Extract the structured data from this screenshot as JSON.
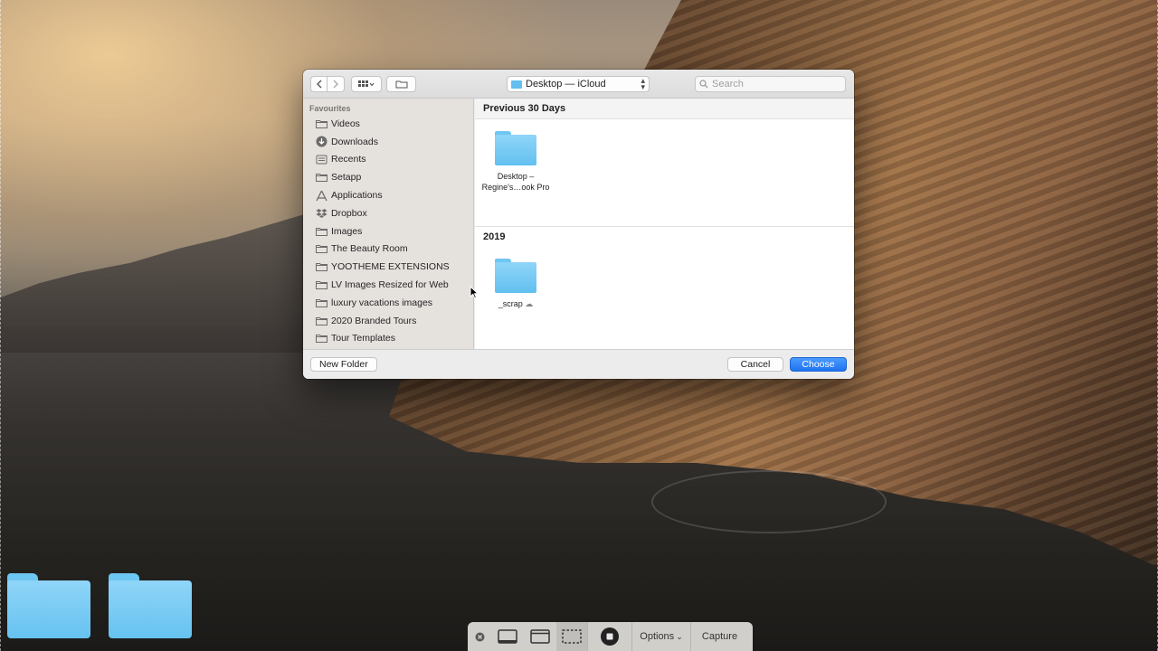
{
  "toolbar": {
    "back_icon": "chevron-left-icon",
    "forward_icon": "chevron-right-icon",
    "view_icon": "icon-grid-icon",
    "group_icon": "folder-tag-icon",
    "location": "Desktop — iCloud",
    "search_placeholder": "Search"
  },
  "sidebar": {
    "header": "Favourites",
    "items": [
      {
        "label": "Videos",
        "icon": "folder-icon"
      },
      {
        "label": "Downloads",
        "icon": "download-icon"
      },
      {
        "label": "Recents",
        "icon": "recents-icon"
      },
      {
        "label": "Setapp",
        "icon": "folder-icon"
      },
      {
        "label": "Applications",
        "icon": "applications-icon"
      },
      {
        "label": "Dropbox",
        "icon": "dropbox-icon"
      },
      {
        "label": "Images",
        "icon": "folder-icon"
      },
      {
        "label": "The Beauty Room",
        "icon": "folder-icon"
      },
      {
        "label": "YOOTHEME EXTENSIONS",
        "icon": "folder-icon"
      },
      {
        "label": "LV Images Resized for Web",
        "icon": "folder-icon"
      },
      {
        "label": "luxury vacations images",
        "icon": "folder-icon"
      },
      {
        "label": "2020 Branded Tours",
        "icon": "folder-icon"
      },
      {
        "label": "Tour Templates",
        "icon": "folder-icon"
      }
    ]
  },
  "content": {
    "sections": [
      {
        "title": "Previous 30 Days",
        "items": [
          {
            "name_line1": "Desktop –",
            "name_line2": "Regine's…ook Pro"
          }
        ]
      },
      {
        "title": "2019",
        "items": [
          {
            "name_line1": "_scrap",
            "cloud": "☁"
          }
        ]
      }
    ]
  },
  "footer": {
    "new_folder": "New Folder",
    "cancel": "Cancel",
    "choose": "Choose"
  },
  "capture_bar": {
    "options": "Options",
    "capture": "Capture"
  },
  "colors": {
    "accent": "#1f73ef",
    "folder": "#6ec6f2"
  }
}
